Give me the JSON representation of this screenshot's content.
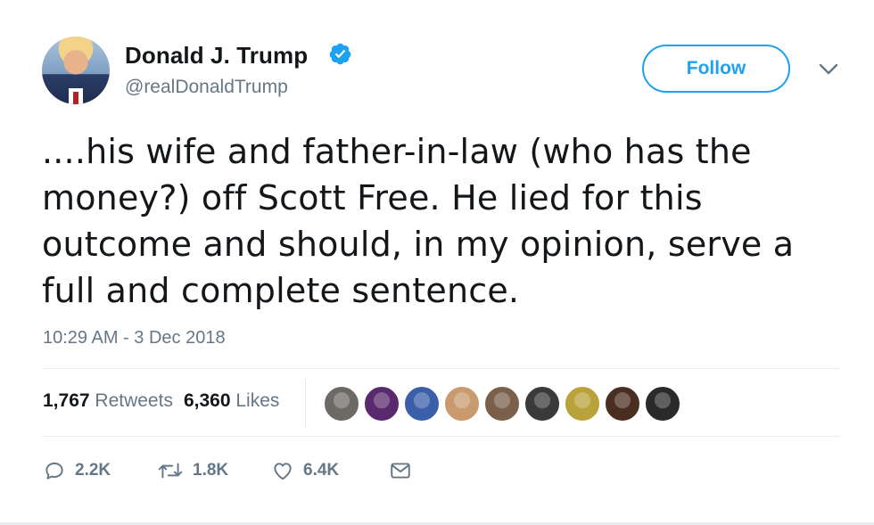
{
  "author": {
    "name": "Donald J. Trump",
    "handle": "@realDonaldTrump",
    "verified": true,
    "avatar_icon": "profile-photo"
  },
  "follow_button": {
    "label": "Follow"
  },
  "tweet": {
    "text": "....his wife and father-in-law (who has the money?) off Scott Free. He lied for this outcome and should, in my opinion, serve a full and complete sentence.",
    "timestamp": "10:29 AM - 3 Dec 2018"
  },
  "stats": {
    "retweets_count": "1,767",
    "retweets_label": "Retweets",
    "likes_count": "6,360",
    "likes_label": "Likes"
  },
  "liker_avatars": [
    {
      "color": "#6d6a66"
    },
    {
      "color": "#5a2a6e"
    },
    {
      "color": "#3b5fa8"
    },
    {
      "color": "#c89a6e"
    },
    {
      "color": "#7a5f4a"
    },
    {
      "color": "#3a3a3a"
    },
    {
      "color": "#b9a23a"
    },
    {
      "color": "#4a2e22"
    },
    {
      "color": "#2a2a2a"
    }
  ],
  "actions": {
    "replies": "2.2K",
    "retweets": "1.8K",
    "likes": "6.4K"
  },
  "colors": {
    "accent": "#1da1f2",
    "secondary_text": "#657786",
    "primary_text": "#14171a",
    "divider": "#e6ecf0"
  }
}
